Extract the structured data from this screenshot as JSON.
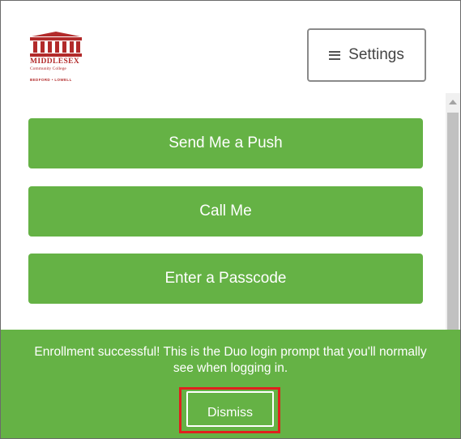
{
  "logo": {
    "name": "MIDDLESEX",
    "subtitle": "Community College",
    "locations": "BEDFORD • LOWELL",
    "icon": "building-columns-icon",
    "color": "#b22a2a"
  },
  "header": {
    "settings_label": "Settings",
    "settings_icon": "hamburger-menu-icon"
  },
  "actions": {
    "push_label": "Send Me a Push",
    "call_label": "Call Me",
    "passcode_label": "Enter a Passcode"
  },
  "banner": {
    "message": "Enrollment successful! This is the Duo login prompt that you'll normally see when logging in.",
    "dismiss_label": "Dismiss"
  },
  "colors": {
    "accent_green": "#65b245",
    "highlight_red": "#e0201e",
    "button_text": "#ffffff"
  }
}
